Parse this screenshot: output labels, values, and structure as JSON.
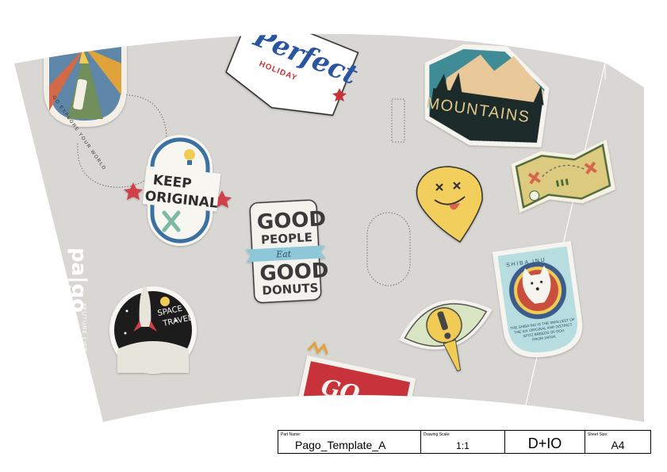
{
  "brand": {
    "logo_text": "pa|go",
    "tagline": "#FUTURE LIFE FACTORY // DONG_IO"
  },
  "stickers": {
    "explore": {
      "text": "GO EXPLORE YOUR WORLD",
      "colors": [
        "#e0a33a",
        "#5d86a8",
        "#d2694a",
        "#6f8f5a"
      ]
    },
    "perfect_holiday": {
      "line1": "Perfect",
      "line2": "HOLIDAY",
      "color": "#2a55a0",
      "accent": "#c8333a"
    },
    "mountains": {
      "text": "MOUNTAINS",
      "sky": "#3f8c96",
      "trees": "#1f2b2b"
    },
    "keep_original": {
      "line1": "KEEP",
      "line2": "ORIGINAL",
      "ring": "#3a6fa3",
      "accent": "#d0404a"
    },
    "good_donuts": {
      "line1": "GOOD",
      "line2": "PEOPLE",
      "line3": "Eat",
      "line4": "GOOD",
      "line5": "DONUTS",
      "ribbon": "#8ec7d8"
    },
    "smiley": {
      "face": "#f2cf5b"
    },
    "treasure_map": {
      "paper": "#dccb7e",
      "x_color": "#d6654e"
    },
    "space_travel": {
      "line1": "SPACE",
      "line2": "TRAVEL"
    },
    "shiba": {
      "title": "SHIBA INU",
      "caption": [
        "THE SHIBA INU IS THE SMALLEST OF",
        "THE SIX ORIGINAL AND DISTINCT",
        "SPITZ BREEDS OF DOG",
        "FROM JAPAN."
      ],
      "badge": "#b7dde0"
    },
    "eye": {
      "iris": "#f0cc57",
      "lid": "#d9e5c2"
    },
    "go_pennant": {
      "text": "GO",
      "color": "#c8303a"
    }
  },
  "title_block": {
    "part_name_label": "Part Name:",
    "part_name": "Pago_Template_A",
    "scale_label": "Drawing Scale:",
    "scale": "1:1",
    "designer": "D+IO",
    "sheet_label": "Sheet Size:",
    "sheet_size": "A4"
  }
}
